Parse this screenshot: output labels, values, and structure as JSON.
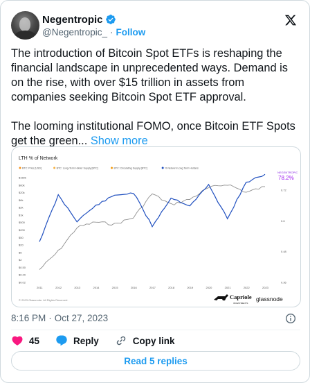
{
  "author": {
    "display_name": "Negentropic",
    "handle": "@Negentropic_",
    "separator": "·",
    "follow_label": "Follow"
  },
  "tweet": {
    "paragraph_1": "The introduction of Bitcoin Spot ETFs is reshaping the financial landscape in unprecedented ways. Demand is on the rise, with over $15 trillion in assets from companies seeking Bitcoin Spot ETF approval.",
    "paragraph_2": "The looming institutional FOMO, once Bitcoin ETF Spots get the green...",
    "show_more": "Show more"
  },
  "media": {
    "title": "LTH % of Network",
    "legend": [
      {
        "label": "BTC: Price [USD]",
        "color": "#f7931a"
      },
      {
        "label": "BTC: Long-Term Holder Supply [BTC]",
        "color": "#f5b041"
      },
      {
        "label": "BTC: Circulating Supply [BTC]",
        "color": "#f39c12"
      },
      {
        "label": "% Network Long Term Holders",
        "color": "#1f4fbf"
      }
    ],
    "current_value_label": "NEGENTROPIC",
    "current_value": "78.2%",
    "copyright": "© 2023 Glassnode. All Rights Reserved.",
    "brand_1": "Capriole",
    "brand_1_sub": "INVESTMENTS",
    "brand_2": "glassnode"
  },
  "chart_data": {
    "type": "line",
    "title": "LTH % of Network",
    "x": [
      "2011",
      "2012",
      "2013",
      "2014",
      "2015",
      "2016",
      "2017",
      "2018",
      "2019",
      "2020",
      "2021",
      "2022",
      "2023"
    ],
    "left_axis_ticks": [
      "$150k",
      "$60k",
      "$20k",
      "$6k",
      "$2k",
      "$1k",
      "$500",
      "$200",
      "$50",
      "$20",
      "$5",
      "$2",
      "$0.50",
      "$0.20",
      "$0.02"
    ],
    "right_axis_ticks": [
      "0.72",
      "0.6",
      "0.48",
      "0.36"
    ],
    "series": [
      {
        "name": "BTC: Price [USD]",
        "color": "#8f8f8f",
        "values": [
          1,
          10,
          200,
          400,
          300,
          700,
          14000,
          3500,
          7000,
          29000,
          47000,
          16500,
          34000
        ]
      },
      {
        "name": "% Network Long Term Holders",
        "color": "#1f4fbf",
        "values": [
          0.52,
          0.7,
          0.6,
          0.66,
          0.7,
          0.71,
          0.58,
          0.69,
          0.66,
          0.74,
          0.61,
          0.75,
          0.782
        ]
      }
    ]
  },
  "meta": {
    "time": "8:16 PM",
    "separator": "·",
    "date": "Oct 27, 2023"
  },
  "actions": {
    "likes_count": "45",
    "reply_label": "Reply",
    "copy_link_label": "Copy link"
  },
  "footer": {
    "read_replies_label": "Read 5 replies"
  }
}
